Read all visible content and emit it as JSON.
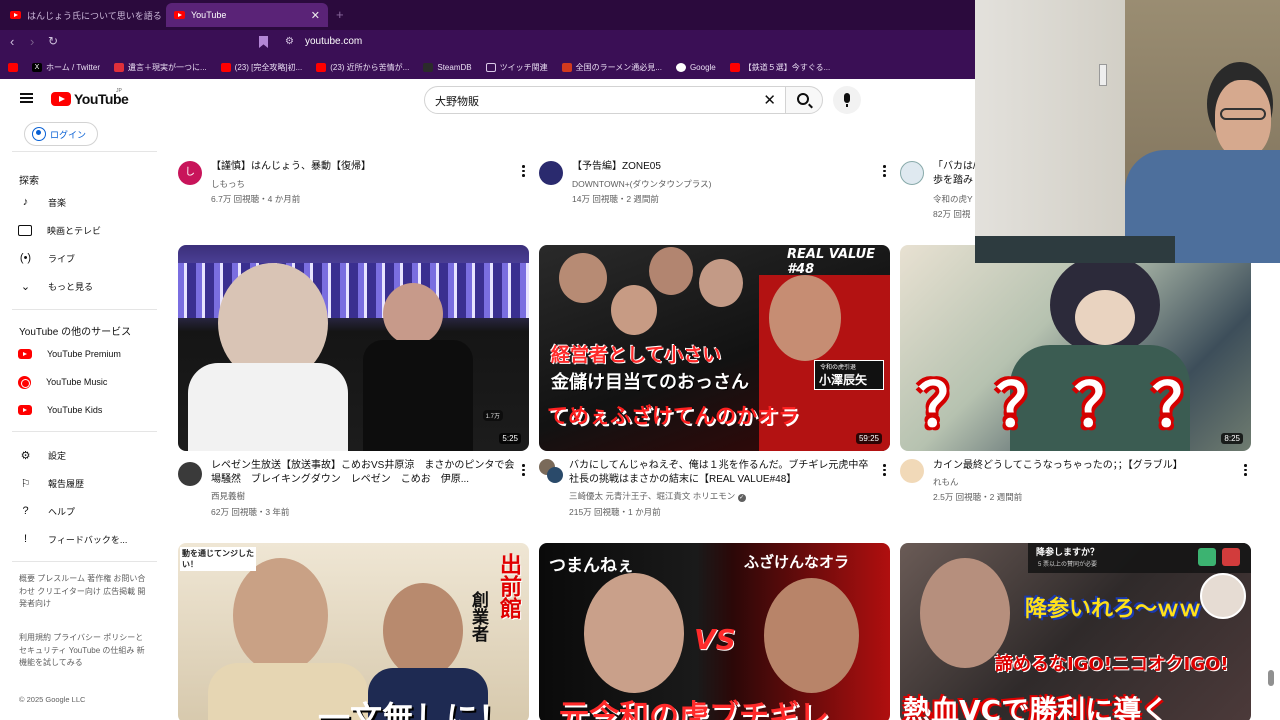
{
  "browser": {
    "tabs": [
      {
        "label": "はんじょう氏について思いを語る加藤純一"
      },
      {
        "label": "YouTube"
      }
    ],
    "url": "youtube.com",
    "bookmarks": [
      {
        "label": "",
        "icon": "youtube-icon"
      },
      {
        "label": "ホーム / Twitter",
        "icon": "x-icon"
      },
      {
        "label": "遺言＋現実が一つに...",
        "icon": "app-icon"
      },
      {
        "label": "(23) [完全攻略]初...",
        "icon": "youtube-icon"
      },
      {
        "label": "(23) 近所から苦情が...",
        "icon": "youtube-icon"
      },
      {
        "label": "SteamDB",
        "icon": "steam-icon"
      },
      {
        "label": "ツイッチ関連",
        "icon": "folder-icon"
      },
      {
        "label": "全国のラーメン通必見...",
        "icon": "ramen-icon"
      },
      {
        "label": "Google",
        "icon": "google-icon"
      },
      {
        "label": "【鉄道５選】今すぐる...",
        "icon": "youtube-icon"
      }
    ]
  },
  "youtube": {
    "logo_text": "YouTube",
    "logo_region": "JP",
    "search_value": "大野物販",
    "login_label": "ログイン",
    "sidebar": {
      "explore_heading": "探索",
      "explore": [
        {
          "label": "音楽",
          "icon": "music-note-icon"
        },
        {
          "label": "映画とテレビ",
          "icon": "movie-icon"
        },
        {
          "label": "ライブ",
          "icon": "live-icon"
        },
        {
          "label": "もっと見る",
          "icon": "chevron-down-icon"
        }
      ],
      "services_heading": "YouTube の他のサービス",
      "services": [
        {
          "label": "YouTube Premium",
          "icon": "youtube-premium-icon"
        },
        {
          "label": "YouTube Music",
          "icon": "youtube-music-icon"
        },
        {
          "label": "YouTube Kids",
          "icon": "youtube-kids-icon"
        }
      ],
      "settings": [
        {
          "label": "設定",
          "icon": "gear-icon"
        },
        {
          "label": "報告履歴",
          "icon": "flag-icon"
        },
        {
          "label": "ヘルプ",
          "icon": "help-icon"
        },
        {
          "label": "フィードバックを...",
          "icon": "feedback-icon"
        }
      ],
      "footer_links_1": "概要 プレスルーム 著作権 お問い合わせ クリエイター向け 広告掲載 開発者向け",
      "footer_links_2": "利用規約 プライバシー ポリシーとセキュリティ YouTube の仕組み 新機能を試してみる",
      "copyright": "© 2025 Google LLC"
    },
    "videos_row0": [
      {
        "title": "【謹慎】はんじょう、暴動【復帰】",
        "channel": "しもっち",
        "stats": "6.7万 回視聴・4 か月前",
        "avatar_letter": "し"
      },
      {
        "title": "【予告編】ZONE05",
        "channel": "DOWNTOWN+(ダウンタウンプラス)",
        "stats": "14万 回視聴・2 週間前"
      },
      {
        "title": "「バカは/",
        "title2": "歩を踏み",
        "channel": "令和の虎Y",
        "stats": "82万 回視"
      }
    ],
    "videos_row1": [
      {
        "title": "レペゼン生放送【放送事故】こめおVS井原涼　まさかのピンタで会場騒然　ブレイキングダウン　レペゼン　こめお　伊原...",
        "channel": "西見義樹",
        "stats": "62万 回視聴・3 年前",
        "duration": "5:25",
        "thumb_badge": "1.7万"
      },
      {
        "title": "バカにしてんじゃねえぞ、俺は１兆を作るんだ。ブチギレ元虎中卒社長の挑戦はまさかの結末に【REAL VALUE#48】",
        "channel": "三崎優太 元青汁王子、堀江貴文 ホリエモン",
        "stats": "215万 回視聴・1 か月前",
        "duration": "59:25",
        "overlay_top": "REAL VALUE #48",
        "overlay_1": "経営者として小さい",
        "overlay_2": "金儲け目当てのおっさん",
        "overlay_3": "てめぇふざけてんのかオラ",
        "name_tag_small": "令和の虎引退",
        "name_tag": "小澤辰矢"
      },
      {
        "title": "カイン最終どうしてこうなっちゃったの；；【グラブル】",
        "channel": "れもん",
        "stats": "2.5万 回視聴・2 週間前",
        "duration": "8:25",
        "overlay_marks": "？？？？"
      }
    ],
    "videos_row2": [
      {
        "overlay_corner": "動を通じてンジしたい！",
        "overlay_side_1": "出前館",
        "overlay_side_2": "創業者",
        "overlay_bottom": "一文無しに！"
      },
      {
        "overlay_left": "つまんねぇ",
        "overlay_right": "ふざけんなオラ",
        "overlay_vs": "VS",
        "overlay_bottom": "元令和の虎ブチギレ"
      },
      {
        "overlay_top": "降参しますか？",
        "overlay_top_sub": "5 票以上の賛同が必要",
        "overlay_mid": "降参いれろ〜ｗｗ",
        "overlay_mid2": "諦めるなIGO!ニコオクIGO!",
        "overlay_bottom": "熱血VCで勝利に導く"
      }
    ]
  },
  "colors": {
    "browser_bg": "#3a0f55",
    "tab_bar": "#2b0a3d",
    "youtube_red": "#ff0000",
    "link_blue": "#065fd4"
  }
}
